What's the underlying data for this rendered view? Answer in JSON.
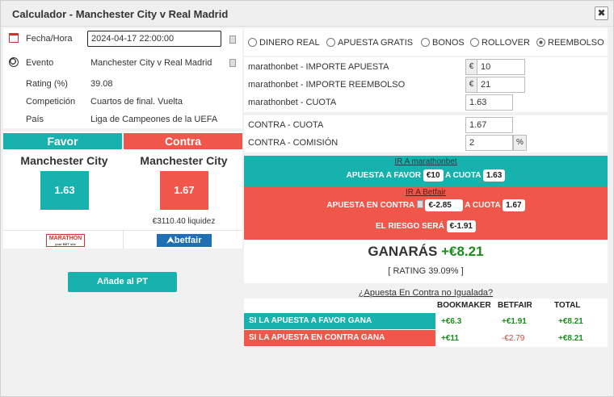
{
  "window": {
    "title": "Calculador - Manchester City v Real Madrid",
    "close_label": "✖"
  },
  "info": {
    "fecha_label": "Fecha/Hora",
    "fecha_value": "2024-04-17 22:00:00",
    "evento_label": "Evento",
    "evento_value": "Manchester City v Real Madrid",
    "rating_label": "Rating (%)",
    "rating_value": "39.08",
    "competicion_label": "Competición",
    "competicion_value": "Cuartos de final. Vuelta",
    "pais_label": "País",
    "pais_value": "Liga de Campeones de la UEFA"
  },
  "favor": {
    "header": "Favor",
    "team": "Manchester City",
    "odds": "1.63",
    "logo_text": "MARATHON",
    "logo_sub": "your BET site",
    "color": "#17b2ad"
  },
  "contra": {
    "header": "Contra",
    "team": "Manchester City",
    "odds": "1.67",
    "liquidity": "€3110.40 liquidez",
    "logo_text": "betfair",
    "color": "#f0564a"
  },
  "add_button": "Añade al PT",
  "modes": [
    {
      "label": "DINERO REAL",
      "selected": false
    },
    {
      "label": "APUESTA GRATIS",
      "selected": false
    },
    {
      "label": "BONOS",
      "selected": false
    },
    {
      "label": "ROLLOVER",
      "selected": false
    },
    {
      "label": "REEMBOLSO",
      "selected": true
    }
  ],
  "form": {
    "importe_apuesta_label": "marathonbet - IMPORTE APUESTA",
    "importe_apuesta_value": "10",
    "importe_reembolso_label": "marathonbet - IMPORTE REEMBOLSO",
    "importe_reembolso_value": "21",
    "cuota_label": "marathonbet - CUOTA",
    "cuota_value": "1.63",
    "contra_cuota_label": "CONTRA - CUOTA",
    "contra_cuota_value": "1.67",
    "contra_comision_label": "CONTRA - COMISIÓN",
    "contra_comision_value": "2",
    "currency": "€",
    "percent": "%"
  },
  "favor_band": {
    "link": "IR A marathonbet",
    "text1": "APUESTA A FAVOR",
    "stake": "€10",
    "text2": "A CUOTA",
    "odds": "1.63"
  },
  "contra_band": {
    "link": "IR A Betfair",
    "text1": "APUESTA EN CONTRA",
    "stake": "€-2.85",
    "text2": "A CUOTA",
    "odds": "1.67",
    "risk_text": "EL RIESGO SERÁ",
    "risk": "€-1.91"
  },
  "result": {
    "label": "GANARÁS",
    "value": "+€8.21",
    "rating": "[ RATING 39.09% ]"
  },
  "unmatched_link": "¿Apuesta En Contra no Igualada?",
  "table": {
    "headers": [
      "BOOKMAKER",
      "BETFAIR",
      "TOTAL"
    ],
    "rows": [
      {
        "label": "SI LA APUESTA A FAVOR GANA",
        "bookmaker": "+€6.3",
        "betfair": "+€1.91",
        "total": "+€8.21"
      },
      {
        "label": "SI LA APUESTA EN CONTRA GANA",
        "bookmaker": "+€11",
        "betfair": "-€2.79",
        "total": "+€8.21"
      }
    ]
  }
}
